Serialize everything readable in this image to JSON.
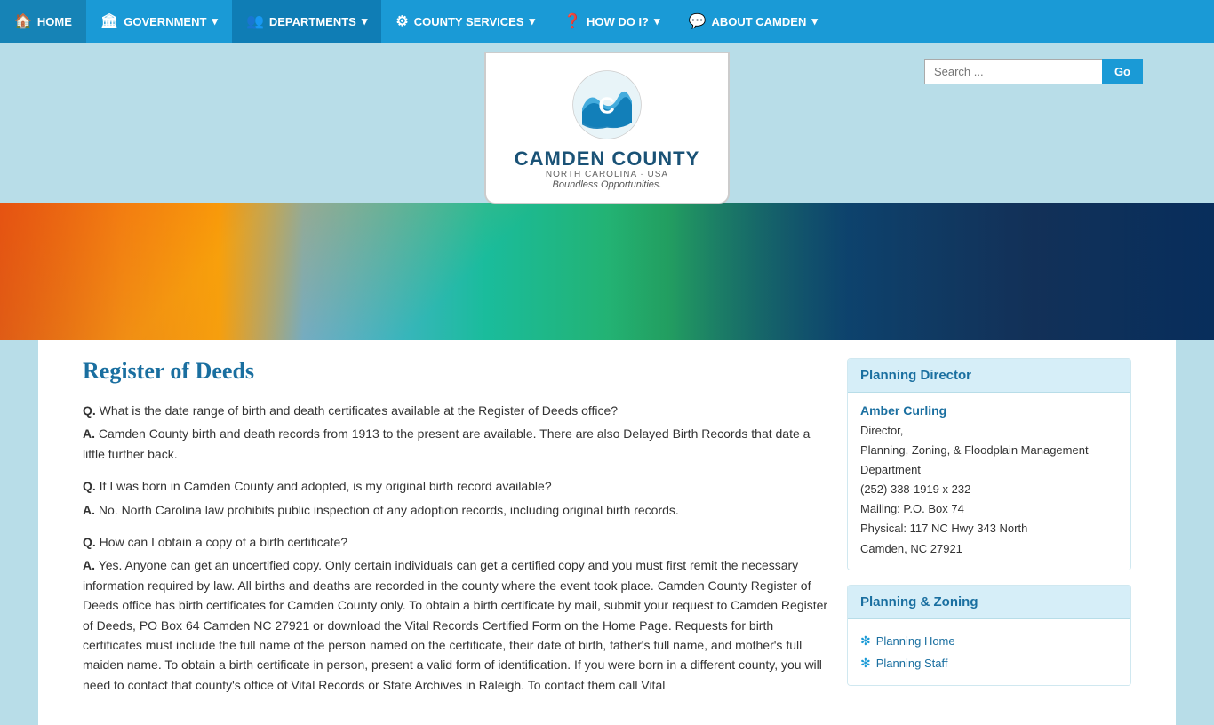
{
  "nav": {
    "items": [
      {
        "id": "home",
        "label": "HOME",
        "icon": "🏠",
        "active": false
      },
      {
        "id": "government",
        "label": "GOVERNMENT",
        "icon": "🏛",
        "active": false,
        "dropdown": true
      },
      {
        "id": "departments",
        "label": "DEPARTMENTS",
        "icon": "👥",
        "active": true,
        "dropdown": true
      },
      {
        "id": "county-services",
        "label": "COUNTY SERVICES",
        "icon": "⚙",
        "active": false,
        "dropdown": true
      },
      {
        "id": "how-do-i",
        "label": "HOW DO I?",
        "icon": "❓",
        "active": false,
        "dropdown": true
      },
      {
        "id": "about-camden",
        "label": "ABOUT CAMDEN",
        "icon": "💬",
        "active": false,
        "dropdown": true
      }
    ]
  },
  "search": {
    "placeholder": "Search ...",
    "button_label": "Go"
  },
  "logo": {
    "title": "CAMDEN COUNTY",
    "subtitle": "NORTH CAROLINA · USA",
    "tagline": "Boundless Opportunities."
  },
  "page": {
    "title": "Register of Deeds",
    "faqs": [
      {
        "q": "What is the date range of birth and death certificates available at the Register of Deeds office?",
        "a": "Camden County birth and death records from 1913 to the present are available. There are also Delayed Birth Records that date a little further back."
      },
      {
        "q": "If I was born in Camden County and adopted, is my original birth record available?",
        "a": "No. North Carolina law prohibits public inspection of any adoption records, including original birth records."
      },
      {
        "q": "How can I obtain a copy of a birth certificate?",
        "a": "Yes. Anyone can get an uncertified copy. Only certain individuals can get a certified copy and you must first remit the necessary information required by law. All births and deaths are recorded in the county where the event took place. Camden County Register of Deeds office has birth certificates for Camden County only. To obtain a birth certificate by mail, submit your request to Camden Register of Deeds, PO Box 64 Camden NC 27921 or download the Vital Records Certified Form on the Home Page. Requests for birth certificates must include the full name of the person named on the certificate, their date of birth, father's full name, and mother's full maiden name. To obtain a birth certificate in person, present a valid form of identification. If you were born in a different county, you will need to contact that county's office of Vital Records or State Archives in Raleigh. To contact them call Vital"
      }
    ]
  },
  "sidebar": {
    "boxes": [
      {
        "id": "planning-director",
        "header": "Planning Director",
        "contact_name": "Amber Curling",
        "contact_details": [
          "Director,",
          "Planning, Zoning, & Floodplain Management Department",
          "(252) 338-1919 x 232",
          "Mailing:  P.O. Box 74",
          "Physical:  117 NC Hwy 343 North",
          "Camden, NC  27921"
        ]
      },
      {
        "id": "planning-zoning",
        "header": "Planning & Zoning",
        "links": [
          {
            "label": "Planning Home"
          },
          {
            "label": "Planning Staff"
          }
        ]
      }
    ]
  }
}
